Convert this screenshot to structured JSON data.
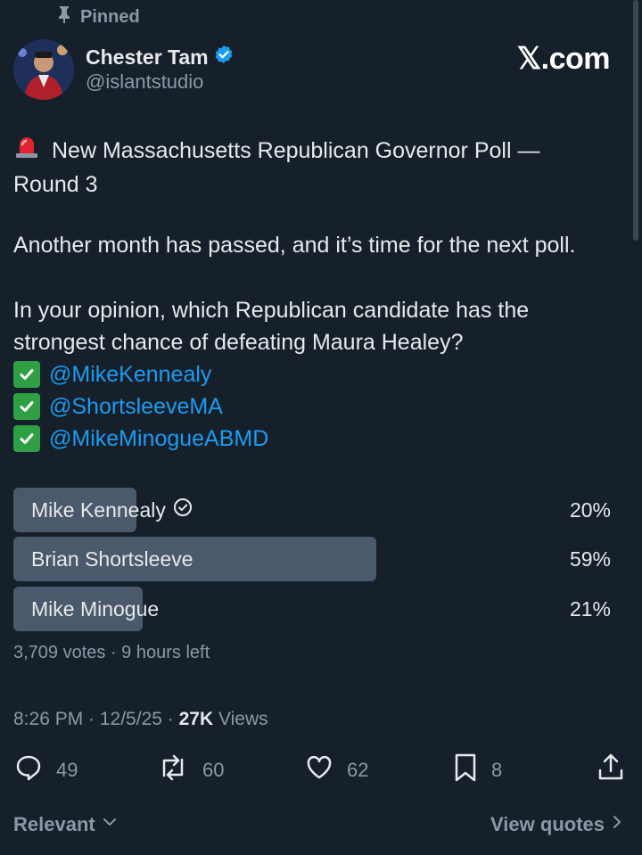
{
  "pinned_label": "Pinned",
  "author": {
    "name": "Chester Tam",
    "handle": "@islantstudio",
    "verified": true
  },
  "brand": "𝕏.com",
  "post": {
    "title_line1": "New Massachusetts Republican Governor Poll —",
    "title_line2": "Round 3",
    "para2": "Another month has passed, and it’s time for the next poll.",
    "para3_line1": "In your opinion, which Republican candidate has the",
    "para3_line2": "strongest chance of defeating Maura Healey?",
    "mentions": [
      "@MikeKennealy",
      "@ShortsleeveMA",
      "@MikeMinogueABMD"
    ]
  },
  "poll": {
    "options": [
      {
        "label": "Mike Kennealy",
        "percent_label": "20%",
        "percent": 20,
        "selected": true
      },
      {
        "label": "Brian Shortsleeve",
        "percent_label": "59%",
        "percent": 59,
        "selected": false
      },
      {
        "label": "Mike Minogue",
        "percent_label": "21%",
        "percent": 21,
        "selected": false
      }
    ],
    "meta": "3,709 votes · 9 hours left"
  },
  "stats": {
    "time": "8:26 PM · 12/5/25 · ",
    "views_count": "27K",
    "views_label": " Views"
  },
  "actions": {
    "replies": "49",
    "reposts": "60",
    "likes": "62",
    "bookmarks": "8"
  },
  "footer": {
    "relevant": "Relevant",
    "view_quotes": "View quotes"
  },
  "colors": {
    "background": "#15202b",
    "bar": "#4a596b",
    "link": "#1d9bf0",
    "verified": "#1d9bf0"
  }
}
